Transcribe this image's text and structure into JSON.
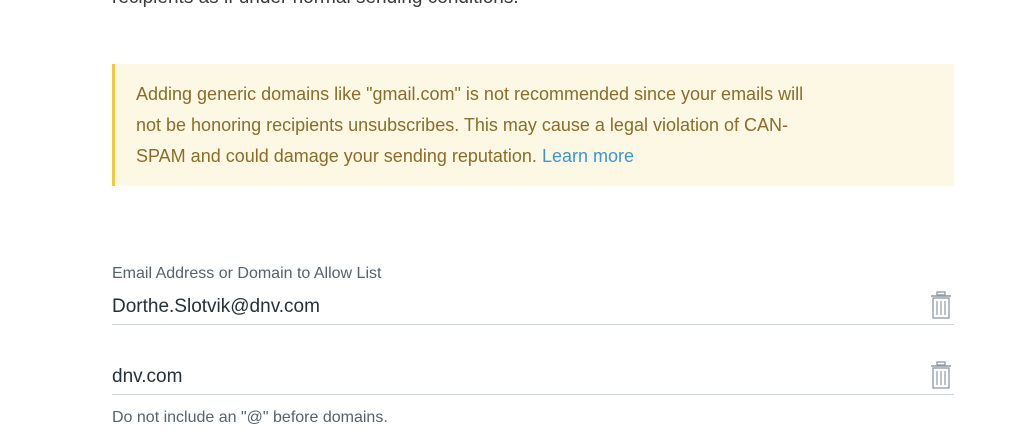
{
  "top_cut_text": "recipients as if under normal sending conditions.",
  "alert": {
    "message_line1": "Adding generic domains like \"gmail.com\" is not recommended since your emails will",
    "message_line2": "not be honoring recipients unsubscribes. This may cause a legal violation of CAN-",
    "message_line3": "SPAM and could damage your sending reputation.",
    "link_text": "Learn more"
  },
  "allow_list": {
    "label": "Email Address or Domain to Allow List",
    "entries": [
      {
        "value": "Dorthe.Slotvik@dnv.com",
        "delete_icon": "trash-icon"
      },
      {
        "value": "dnv.com",
        "delete_icon": "trash-icon"
      }
    ],
    "helper_text": "Do not include an \"@\" before domains."
  },
  "colors": {
    "alert_background": "#fdf8e3",
    "alert_border": "#f5c842",
    "alert_text": "#8a6d2a",
    "link": "#3b95d9"
  }
}
